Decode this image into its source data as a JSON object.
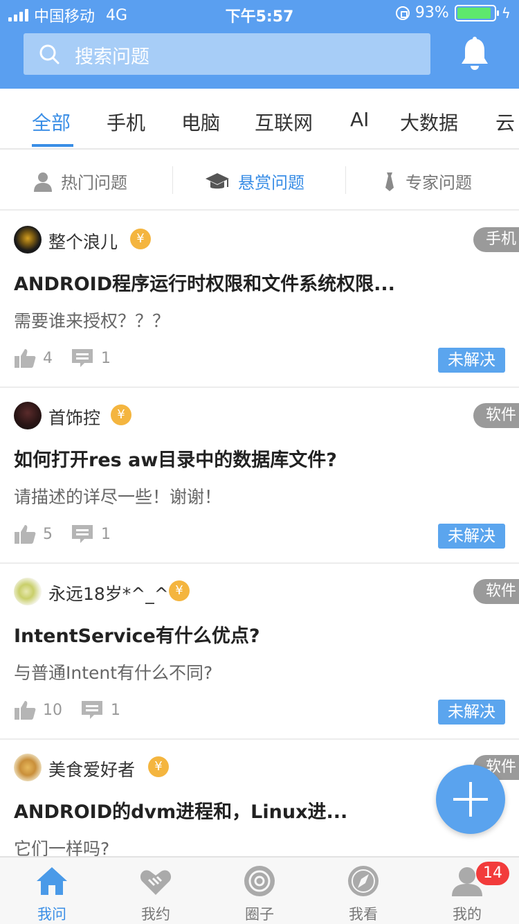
{
  "status_bar": {
    "carrier": "中国移动",
    "network": "4G",
    "time": "下午5:57",
    "battery": "93%",
    "battery_level": 0.93
  },
  "search": {
    "placeholder": "搜索问题"
  },
  "tabs": [
    {
      "label": "全部",
      "active": true
    },
    {
      "label": "手机",
      "active": false
    },
    {
      "label": "电脑",
      "active": false
    },
    {
      "label": "互联网",
      "active": false
    },
    {
      "label": "AI",
      "active": false
    },
    {
      "label": "大数据",
      "active": false
    },
    {
      "label": "云",
      "active": false
    }
  ],
  "filters": [
    {
      "label": "热门问题",
      "icon": "user-icon",
      "active": false
    },
    {
      "label": "悬赏问题",
      "icon": "graduation-cap-icon",
      "active": true
    },
    {
      "label": "专家问题",
      "icon": "tie-icon",
      "active": false
    }
  ],
  "questions": [
    {
      "user": "整个浪儿",
      "tag": "手机",
      "title": "ANDROID程序运行时权限和文件系统权限...",
      "desc": "需要谁来授权？？？",
      "likes": "4",
      "comments": "1",
      "status": "未解决",
      "coin": "¥"
    },
    {
      "user": "首饰控",
      "tag": "软件",
      "title": "如何打开res aw目录中的数据库文件?",
      "desc": "请描述的详尽一些！谢谢！",
      "likes": "5",
      "comments": "1",
      "status": "未解决",
      "coin": "¥"
    },
    {
      "user": "永远18岁*^_^*",
      "tag": "软件",
      "title": "IntentService有什么优点?",
      "desc": "与普通Intent有什么不同?",
      "likes": "10",
      "comments": "1",
      "status": "未解决",
      "coin": "¥"
    },
    {
      "user": "美食爱好者",
      "tag": "软件",
      "title": "ANDROID的dvm进程和，Linux进...",
      "desc": "它们一样吗?",
      "coin": "¥"
    }
  ],
  "bottom_nav": [
    {
      "label": "我问",
      "icon": "home-icon",
      "active": true
    },
    {
      "label": "我约",
      "icon": "handshake-icon",
      "active": false
    },
    {
      "label": "圈子",
      "icon": "circle-icon",
      "active": false
    },
    {
      "label": "我看",
      "icon": "compass-icon",
      "active": false
    },
    {
      "label": "我的",
      "icon": "profile-icon",
      "active": false
    }
  ],
  "badge_count": "14",
  "colors": {
    "header": "#5a9ff0",
    "accent": "#3a8ee6",
    "status_badge": "#5ba5ee",
    "notification_badge": "#f23b3b",
    "coin": "#f4b53f"
  }
}
